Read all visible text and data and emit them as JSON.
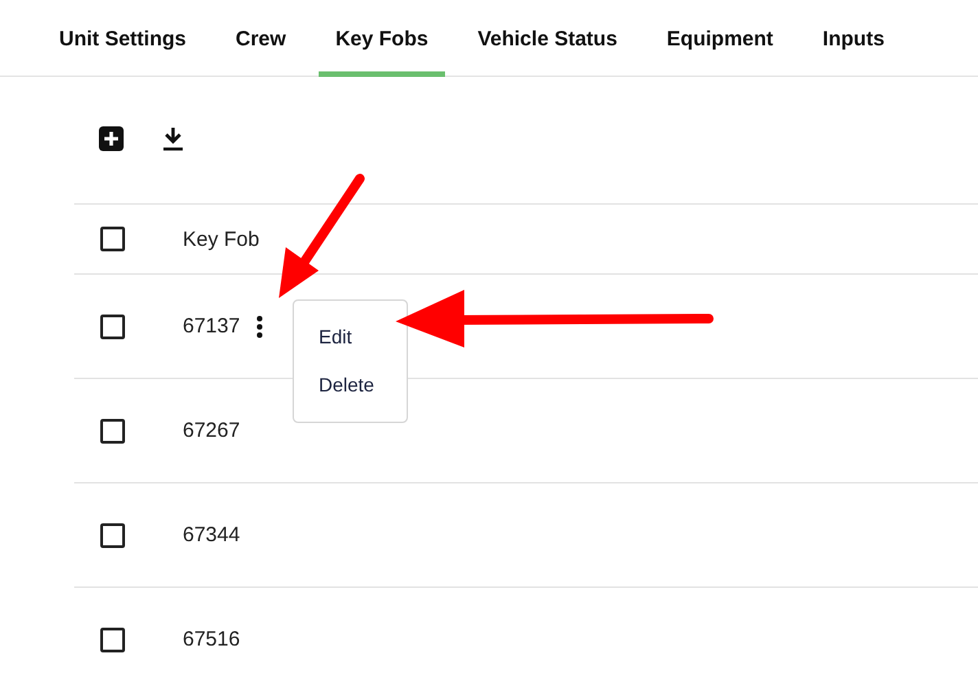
{
  "tabs": [
    {
      "label": "Unit Settings",
      "selected": false
    },
    {
      "label": "Crew",
      "selected": false
    },
    {
      "label": "Key Fobs",
      "selected": true
    },
    {
      "label": "Vehicle Status",
      "selected": false
    },
    {
      "label": "Equipment",
      "selected": false
    },
    {
      "label": "Inputs",
      "selected": false
    }
  ],
  "table": {
    "columns": [
      "Key Fob"
    ],
    "header_checked": false,
    "rows": [
      {
        "key_fob": "67137",
        "checked": false,
        "menu": {
          "items": [
            "Edit",
            "Delete"
          ]
        }
      },
      {
        "key_fob": "67267",
        "checked": false
      },
      {
        "key_fob": "67344",
        "checked": false
      },
      {
        "key_fob": "67516",
        "checked": false
      }
    ]
  }
}
